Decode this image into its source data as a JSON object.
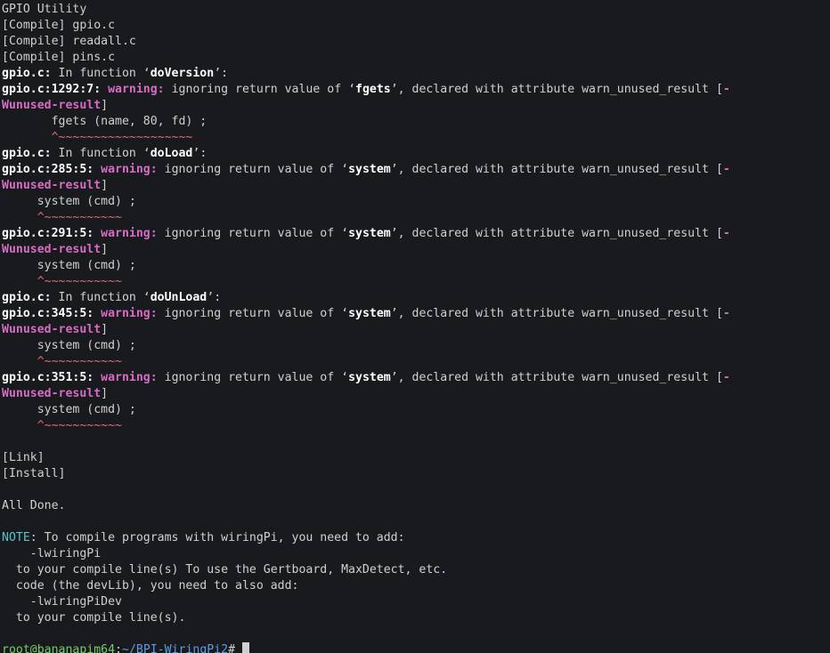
{
  "lines": [
    [
      {
        "cls": "c-w",
        "t": "GPIO Utility"
      }
    ],
    [
      {
        "cls": "c-w",
        "t": "[Compile] gpio.c"
      }
    ],
    [
      {
        "cls": "c-w",
        "t": "[Compile] readall.c"
      }
    ],
    [
      {
        "cls": "c-w",
        "t": "[Compile] pins.c"
      }
    ],
    [
      {
        "cls": "c-bw",
        "t": "gpio.c:"
      },
      {
        "cls": "c-w",
        "t": " In function ‘"
      },
      {
        "cls": "c-bw",
        "t": "doVersion"
      },
      {
        "cls": "c-w",
        "t": "’:"
      }
    ],
    [
      {
        "cls": "c-bw",
        "t": "gpio.c:1292:7:"
      },
      {
        "cls": "c-w",
        "t": " "
      },
      {
        "cls": "c-bmag",
        "t": "warning: "
      },
      {
        "cls": "c-w",
        "t": "ignoring return value of ‘"
      },
      {
        "cls": "c-bw",
        "t": "fgets"
      },
      {
        "cls": "c-w",
        "t": "’, declared with attribute warn_unused_result ["
      },
      {
        "cls": "c-bmag",
        "t": "-"
      }
    ],
    [
      {
        "cls": "c-bmag",
        "t": "Wunused-result"
      },
      {
        "cls": "c-w",
        "t": "]"
      }
    ],
    [
      {
        "cls": "c-w",
        "t": "       fgets (name, 80, fd) ;"
      }
    ],
    [
      {
        "cls": "c-red",
        "t": "       ^~~~~~~~~~~~~~~~~~~~"
      }
    ],
    [
      {
        "cls": "c-bw",
        "t": "gpio.c:"
      },
      {
        "cls": "c-w",
        "t": " In function ‘"
      },
      {
        "cls": "c-bw",
        "t": "doLoad"
      },
      {
        "cls": "c-w",
        "t": "’:"
      }
    ],
    [
      {
        "cls": "c-bw",
        "t": "gpio.c:285:5:"
      },
      {
        "cls": "c-w",
        "t": " "
      },
      {
        "cls": "c-bmag",
        "t": "warning: "
      },
      {
        "cls": "c-w",
        "t": "ignoring return value of ‘"
      },
      {
        "cls": "c-bw",
        "t": "system"
      },
      {
        "cls": "c-w",
        "t": "’, declared with attribute warn_unused_result ["
      },
      {
        "cls": "c-bmag",
        "t": "-"
      }
    ],
    [
      {
        "cls": "c-bmag",
        "t": "Wunused-result"
      },
      {
        "cls": "c-w",
        "t": "]"
      }
    ],
    [
      {
        "cls": "c-w",
        "t": "     system (cmd) ;"
      }
    ],
    [
      {
        "cls": "c-red",
        "t": "     ^~~~~~~~~~~~"
      }
    ],
    [
      {
        "cls": "c-bw",
        "t": "gpio.c:291:5:"
      },
      {
        "cls": "c-w",
        "t": " "
      },
      {
        "cls": "c-bmag",
        "t": "warning: "
      },
      {
        "cls": "c-w",
        "t": "ignoring return value of ‘"
      },
      {
        "cls": "c-bw",
        "t": "system"
      },
      {
        "cls": "c-w",
        "t": "’, declared with attribute warn_unused_result ["
      },
      {
        "cls": "c-bmag",
        "t": "-"
      }
    ],
    [
      {
        "cls": "c-bmag",
        "t": "Wunused-result"
      },
      {
        "cls": "c-w",
        "t": "]"
      }
    ],
    [
      {
        "cls": "c-w",
        "t": "     system (cmd) ;"
      }
    ],
    [
      {
        "cls": "c-red",
        "t": "     ^~~~~~~~~~~~"
      }
    ],
    [
      {
        "cls": "c-bw",
        "t": "gpio.c:"
      },
      {
        "cls": "c-w",
        "t": " In function ‘"
      },
      {
        "cls": "c-bw",
        "t": "doUnLoad"
      },
      {
        "cls": "c-w",
        "t": "’:"
      }
    ],
    [
      {
        "cls": "c-bw",
        "t": "gpio.c:345:5:"
      },
      {
        "cls": "c-w",
        "t": " "
      },
      {
        "cls": "c-bmag",
        "t": "warning: "
      },
      {
        "cls": "c-w",
        "t": "ignoring return value of ‘"
      },
      {
        "cls": "c-bw",
        "t": "system"
      },
      {
        "cls": "c-w",
        "t": "’, declared with attribute warn_unused_result ["
      },
      {
        "cls": "c-bmag",
        "t": "-"
      }
    ],
    [
      {
        "cls": "c-bmag",
        "t": "Wunused-result"
      },
      {
        "cls": "c-w",
        "t": "]"
      }
    ],
    [
      {
        "cls": "c-w",
        "t": "     system (cmd) ;"
      }
    ],
    [
      {
        "cls": "c-red",
        "t": "     ^~~~~~~~~~~~"
      }
    ],
    [
      {
        "cls": "c-bw",
        "t": "gpio.c:351:5:"
      },
      {
        "cls": "c-w",
        "t": " "
      },
      {
        "cls": "c-bmag",
        "t": "warning: "
      },
      {
        "cls": "c-w",
        "t": "ignoring return value of ‘"
      },
      {
        "cls": "c-bw",
        "t": "system"
      },
      {
        "cls": "c-w",
        "t": "’, declared with attribute warn_unused_result ["
      },
      {
        "cls": "c-bmag",
        "t": "-"
      }
    ],
    [
      {
        "cls": "c-bmag",
        "t": "Wunused-result"
      },
      {
        "cls": "c-w",
        "t": "]"
      }
    ],
    [
      {
        "cls": "c-w",
        "t": "     system (cmd) ;"
      }
    ],
    [
      {
        "cls": "c-red",
        "t": "     ^~~~~~~~~~~~"
      }
    ],
    [
      {
        "cls": "c-w",
        "t": ""
      }
    ],
    [
      {
        "cls": "c-w",
        "t": "[Link]"
      }
    ],
    [
      {
        "cls": "c-w",
        "t": "[Install]"
      }
    ],
    [
      {
        "cls": "c-w",
        "t": ""
      }
    ],
    [
      {
        "cls": "c-w",
        "t": "All Done."
      }
    ],
    [
      {
        "cls": "c-w",
        "t": ""
      }
    ],
    [
      {
        "cls": "c-cyn",
        "t": "NOTE"
      },
      {
        "cls": "c-w",
        "t": ": To compile programs with wiringPi, you need to add:"
      }
    ],
    [
      {
        "cls": "c-w",
        "t": "    -lwiringPi"
      }
    ],
    [
      {
        "cls": "c-w",
        "t": "  to your compile line(s) To use the Gertboard, MaxDetect, etc."
      }
    ],
    [
      {
        "cls": "c-w",
        "t": "  code (the devLib), you need to also add:"
      }
    ],
    [
      {
        "cls": "c-w",
        "t": "    -lwiringPiDev"
      }
    ],
    [
      {
        "cls": "c-w",
        "t": "  to your compile line(s)."
      }
    ],
    [
      {
        "cls": "c-w",
        "t": ""
      }
    ]
  ],
  "prompt": {
    "user_host": "root@bananapim64",
    "sep1": ":",
    "path": "~/BPI-WiringPi2",
    "sep2": "# "
  }
}
